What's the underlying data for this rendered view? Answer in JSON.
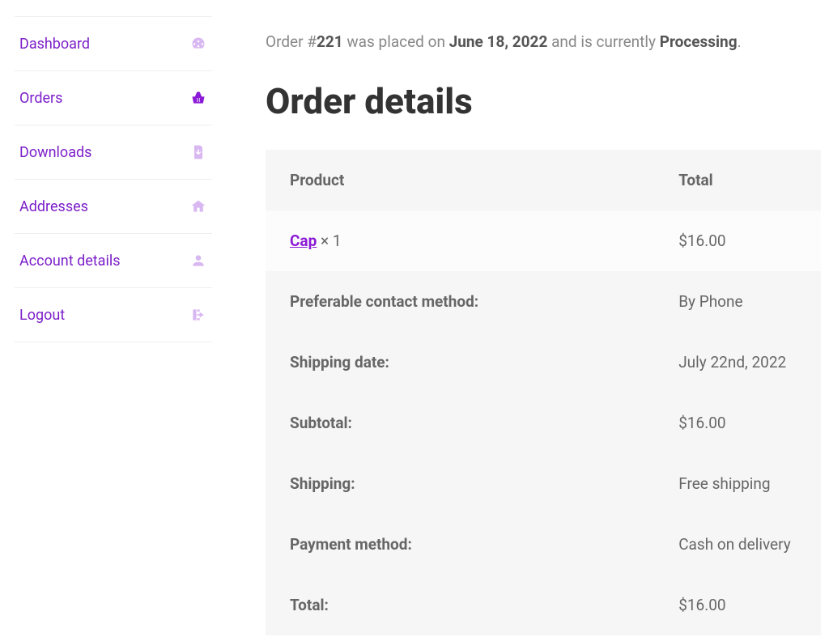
{
  "sidebar": {
    "items": [
      {
        "label": "Dashboard",
        "icon": "gauge-icon",
        "strong": false
      },
      {
        "label": "Orders",
        "icon": "basket-icon",
        "strong": true
      },
      {
        "label": "Downloads",
        "icon": "file-icon",
        "strong": false
      },
      {
        "label": "Addresses",
        "icon": "home-icon",
        "strong": false
      },
      {
        "label": "Account details",
        "icon": "user-icon",
        "strong": false
      },
      {
        "label": "Logout",
        "icon": "logout-icon",
        "strong": false
      }
    ]
  },
  "order": {
    "status_prefix": "Order #",
    "number": "221",
    "status_mid1": " was placed on ",
    "date": "June 18, 2022",
    "status_mid2": " and is currently ",
    "status": "Processing",
    "status_suffix": "."
  },
  "details": {
    "title": "Order details",
    "header_product": "Product",
    "header_total": "Total",
    "line_item": {
      "name": "Cap",
      "qty_text": " × 1",
      "total": "$16.00"
    },
    "rows": [
      {
        "label": "Preferable contact method:",
        "value": "By Phone"
      },
      {
        "label": "Shipping date:",
        "value": "July 22nd, 2022"
      },
      {
        "label": "Subtotal:",
        "value": "$16.00"
      },
      {
        "label": "Shipping:",
        "value": "Free shipping"
      },
      {
        "label": "Payment method:",
        "value": "Cash on delivery"
      },
      {
        "label": "Total:",
        "value": "$16.00"
      }
    ]
  }
}
